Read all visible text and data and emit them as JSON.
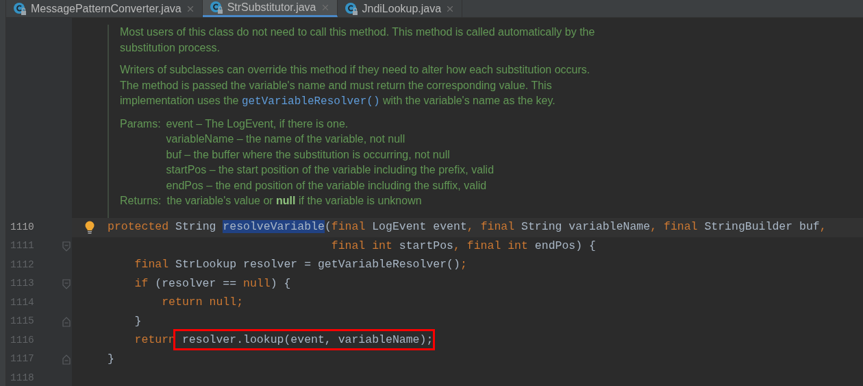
{
  "tabs": [
    {
      "label": "MessagePatternConverter.java",
      "selected": false
    },
    {
      "label": "StrSubstitutor.java",
      "selected": true
    },
    {
      "label": "JndiLookup.java",
      "selected": false
    }
  ],
  "doc": {
    "paragraphs": [
      [
        [
          {
            "kind": "text",
            "text": "Most users of this class do not need to call this method. This method is called automatically by the"
          }
        ],
        [
          {
            "kind": "text",
            "text": "substitution process."
          }
        ]
      ],
      [
        [
          {
            "kind": "text",
            "text": "Writers of subclasses can override this method if they need to alter how each substitution occurs."
          }
        ],
        [
          {
            "kind": "text",
            "text": "The method is passed the variable's name and must return the corresponding value. This"
          }
        ],
        [
          {
            "kind": "text",
            "text": "implementation uses the "
          },
          {
            "kind": "code",
            "text": "getVariableResolver()"
          },
          {
            "kind": "text",
            "text": " with the variable's name as the key."
          }
        ]
      ]
    ],
    "params_label": "Params:",
    "params": [
      "event – The LogEvent, if there is one.",
      "variableName – the name of the variable, not null",
      "buf – the buffer where the substitution is occurring, not null",
      "startPos – the start position of the variable including the prefix, valid",
      "endPos – the end position of the variable including the suffix, valid"
    ],
    "returns_label": "Returns:",
    "returns": "the variable's value or **null** if the variable is unknown"
  },
  "code": [
    {
      "number": "1110",
      "current": true,
      "bulb": true,
      "fold_open": false,
      "fold_close": false,
      "tokens": [
        {
          "kind": "keyword",
          "text": "protected "
        },
        {
          "kind": "plain",
          "text": "String "
        },
        {
          "kind": "selected",
          "text": "resolveVariable"
        },
        {
          "kind": "plain",
          "text": "("
        },
        {
          "kind": "keyword",
          "text": "final "
        },
        {
          "kind": "plain",
          "text": "LogEvent event"
        },
        {
          "kind": "keyword",
          "text": ", final "
        },
        {
          "kind": "plain",
          "text": "String variableName"
        },
        {
          "kind": "keyword",
          "text": ", final "
        },
        {
          "kind": "plain",
          "text": "StringBuilder buf"
        },
        {
          "kind": "keyword",
          "text": ","
        }
      ]
    },
    {
      "number": "1111",
      "current": false,
      "bulb": false,
      "fold_open": true,
      "fold_close": false,
      "tokens": [
        {
          "kind": "keyword",
          "text": "                                 final int "
        },
        {
          "kind": "plain",
          "text": "startPos"
        },
        {
          "kind": "keyword",
          "text": ", final int "
        },
        {
          "kind": "plain",
          "text": "endPos) {"
        }
      ]
    },
    {
      "number": "1112",
      "current": false,
      "bulb": false,
      "fold_open": false,
      "fold_close": false,
      "tokens": [
        {
          "kind": "keyword",
          "text": "    final "
        },
        {
          "kind": "plain",
          "text": "StrLookup resolver = getVariableResolver()"
        },
        {
          "kind": "keyword",
          "text": ";"
        }
      ]
    },
    {
      "number": "1113",
      "current": false,
      "bulb": false,
      "fold_open": true,
      "fold_close": false,
      "tokens": [
        {
          "kind": "keyword",
          "text": "    if "
        },
        {
          "kind": "plain",
          "text": "(resolver == "
        },
        {
          "kind": "keyword",
          "text": "null"
        },
        {
          "kind": "plain",
          "text": ") {"
        }
      ]
    },
    {
      "number": "1114",
      "current": false,
      "bulb": false,
      "fold_open": false,
      "fold_close": false,
      "tokens": [
        {
          "kind": "keyword",
          "text": "        return null;"
        }
      ]
    },
    {
      "number": "1115",
      "current": false,
      "bulb": false,
      "fold_open": false,
      "fold_close": true,
      "tokens": [
        {
          "kind": "plain",
          "text": "    }"
        }
      ]
    },
    {
      "number": "1116",
      "current": false,
      "bulb": false,
      "fold_open": false,
      "fold_close": false,
      "tokens": [
        {
          "kind": "keyword",
          "text": "    return"
        },
        {
          "kind": "boxed",
          "text": " resolver.lookup(event, variableName);"
        }
      ]
    },
    {
      "number": "1117",
      "current": false,
      "bulb": false,
      "fold_open": false,
      "fold_close": true,
      "tokens": [
        {
          "kind": "plain",
          "text": "}"
        }
      ]
    },
    {
      "number": "1118",
      "current": false,
      "bulb": false,
      "fold_open": false,
      "fold_close": false
    }
  ]
}
